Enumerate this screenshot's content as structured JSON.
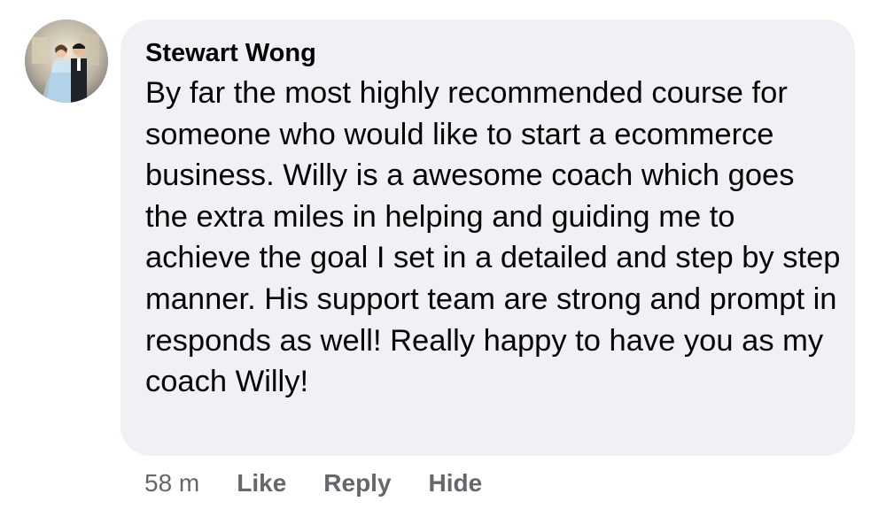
{
  "comment": {
    "author": "Stewart Wong",
    "text": "By far the most highly recommended course for someone who would like to start a ecommerce business. Willy is a awesome coach which goes the extra miles in helping and guiding me to achieve the goal I set in a detailed and step by step manner. His support team are strong and prompt in responds as well! Really happy to have you as my coach Willy!",
    "timestamp": "58 m",
    "actions": {
      "like": "Like",
      "reply": "Reply",
      "hide": "Hide"
    }
  },
  "colors": {
    "bubble_background": "#f0f1f4",
    "text": "#050505",
    "secondary_text": "#65676b"
  }
}
